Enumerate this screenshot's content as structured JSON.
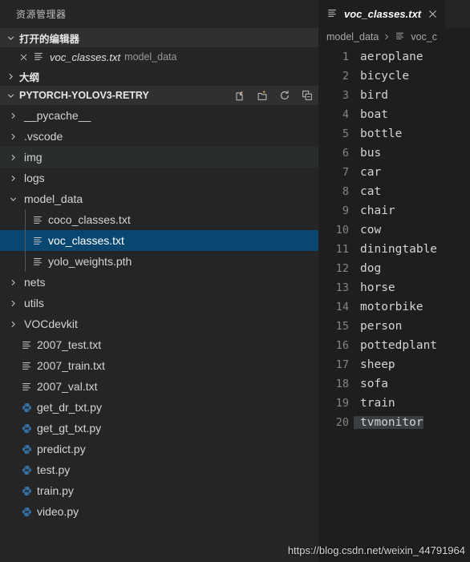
{
  "sidebar": {
    "title": "资源管理器",
    "open_editors": {
      "label": "打开的编辑器",
      "chevron": "chevron-down-icon",
      "items": [
        {
          "close": "close-icon",
          "icon": "text-file-icon",
          "name": "voc_classes.txt",
          "dir": "model_data"
        }
      ]
    },
    "outline": {
      "label": "大纲",
      "chevron": "chevron-right-icon"
    },
    "project": {
      "label": "PYTORCH-YOLOV3-RETRY",
      "chevron": "chevron-down-icon",
      "actions": [
        {
          "name": "new-file-icon",
          "title": "新建文件"
        },
        {
          "name": "new-folder-icon",
          "title": "新建文件夹"
        },
        {
          "name": "refresh-icon",
          "title": "刷新资源管理器"
        },
        {
          "name": "collapse-all-icon",
          "title": "在资源管理器中折叠文件夹"
        }
      ]
    },
    "tree": [
      {
        "label": "__pycache__",
        "type": "folder",
        "expanded": false,
        "depth": 1,
        "state": "normal"
      },
      {
        "label": ".vscode",
        "type": "folder",
        "expanded": false,
        "depth": 1,
        "state": "normal"
      },
      {
        "label": "img",
        "type": "folder",
        "expanded": false,
        "depth": 1,
        "state": "hover"
      },
      {
        "label": "logs",
        "type": "folder",
        "expanded": false,
        "depth": 1,
        "state": "normal"
      },
      {
        "label": "model_data",
        "type": "folder",
        "expanded": true,
        "depth": 1,
        "state": "normal"
      },
      {
        "label": "coco_classes.txt",
        "type": "txt",
        "depth": 2,
        "state": "normal"
      },
      {
        "label": "voc_classes.txt",
        "type": "txt",
        "depth": 2,
        "state": "selected"
      },
      {
        "label": "yolo_weights.pth",
        "type": "txt",
        "depth": 2,
        "state": "normal"
      },
      {
        "label": "nets",
        "type": "folder",
        "expanded": false,
        "depth": 1,
        "state": "normal"
      },
      {
        "label": "utils",
        "type": "folder",
        "expanded": false,
        "depth": 1,
        "state": "normal"
      },
      {
        "label": "VOCdevkit",
        "type": "folder",
        "expanded": false,
        "depth": 1,
        "state": "normal"
      },
      {
        "label": "2007_test.txt",
        "type": "txt",
        "depth": 1,
        "state": "normal"
      },
      {
        "label": "2007_train.txt",
        "type": "txt",
        "depth": 1,
        "state": "normal"
      },
      {
        "label": "2007_val.txt",
        "type": "txt",
        "depth": 1,
        "state": "normal"
      },
      {
        "label": "get_dr_txt.py",
        "type": "py",
        "depth": 1,
        "state": "normal"
      },
      {
        "label": "get_gt_txt.py",
        "type": "py",
        "depth": 1,
        "state": "normal"
      },
      {
        "label": "predict.py",
        "type": "py",
        "depth": 1,
        "state": "normal"
      },
      {
        "label": "test.py",
        "type": "py",
        "depth": 1,
        "state": "normal"
      },
      {
        "label": "train.py",
        "type": "py",
        "depth": 1,
        "state": "normal"
      },
      {
        "label": "video.py",
        "type": "py",
        "depth": 1,
        "state": "normal"
      }
    ]
  },
  "editor": {
    "tab": {
      "icon": "text-file-icon",
      "title": "voc_classes.txt",
      "close": "close-icon"
    },
    "breadcrumb": {
      "folder": "model_data",
      "separator": "chevron-right-icon",
      "file_icon": "text-file-icon",
      "file": "voc_c"
    },
    "lines": [
      {
        "n": "1",
        "text": "aeroplane",
        "selected": false
      },
      {
        "n": "2",
        "text": "bicycle",
        "selected": false
      },
      {
        "n": "3",
        "text": "bird",
        "selected": false
      },
      {
        "n": "4",
        "text": "boat",
        "selected": false
      },
      {
        "n": "5",
        "text": "bottle",
        "selected": false
      },
      {
        "n": "6",
        "text": "bus",
        "selected": false
      },
      {
        "n": "7",
        "text": "car",
        "selected": false
      },
      {
        "n": "8",
        "text": "cat",
        "selected": false
      },
      {
        "n": "9",
        "text": "chair",
        "selected": false
      },
      {
        "n": "10",
        "text": "cow",
        "selected": false
      },
      {
        "n": "11",
        "text": "diningtable",
        "selected": false
      },
      {
        "n": "12",
        "text": "dog",
        "selected": false
      },
      {
        "n": "13",
        "text": "horse",
        "selected": false
      },
      {
        "n": "14",
        "text": "motorbike",
        "selected": false
      },
      {
        "n": "15",
        "text": "person",
        "selected": false
      },
      {
        "n": "16",
        "text": "pottedplant",
        "selected": false
      },
      {
        "n": "17",
        "text": "sheep",
        "selected": false
      },
      {
        "n": "18",
        "text": "sofa",
        "selected": false
      },
      {
        "n": "19",
        "text": "train",
        "selected": false
      },
      {
        "n": "20",
        "text": "tvmonitor",
        "selected": true
      }
    ]
  },
  "watermark": {
    "text": "https://blog.csdn.net/weixin_44791964"
  },
  "colors": {
    "sidebar_bg": "#252526",
    "editor_bg": "#1e1e1e",
    "selection_blue": "#094771",
    "hover_bg": "#2a2d2e",
    "section_bg": "#2f3032",
    "text": "#d4d4d4",
    "line_number": "#858585",
    "py_icon": "#3572A5"
  }
}
